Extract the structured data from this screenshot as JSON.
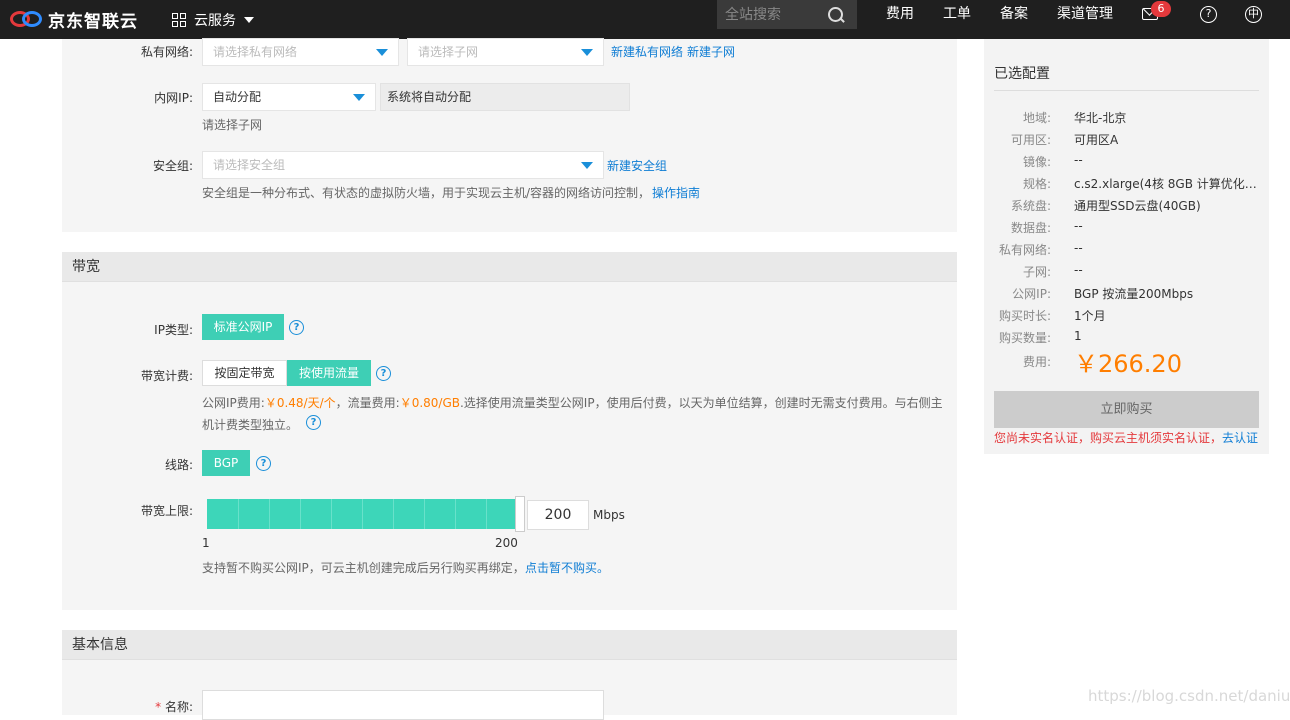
{
  "topbar": {
    "brand": "京东智联云",
    "cloud_menu": "云服务",
    "search_placeholder": "全站搜索",
    "nav": [
      "费用",
      "工单",
      "备案",
      "渠道管理"
    ],
    "mail_count": "6",
    "help_symbol": "?",
    "lang_symbol": "中"
  },
  "network": {
    "vpc_label": "私有网络:",
    "vpc_placeholder": "请选择私有网络",
    "subnet_placeholder": "请选择子网",
    "new_vpc_link": "新建私有网络",
    "new_subnet_link": "新建子网",
    "ip_label": "内网IP:",
    "ip_value": "自动分配",
    "ip_auto_text": "系统将自动分配",
    "ip_hint": "请选择子网",
    "sg_label": "安全组:",
    "sg_placeholder": "请选择安全组",
    "new_sg_link": "新建安全组",
    "sg_hint": "安全组是一种分布式、有状态的虚拟防火墙，用于实现云主机/容器的网络访问控制，",
    "sg_guide_link": "操作指南"
  },
  "bandwidth": {
    "section_title": "带宽",
    "ip_type_label": "IP类型:",
    "ip_type_value": "标准公网IP",
    "billing_label": "带宽计费:",
    "billing_fixed": "按固定带宽",
    "billing_traffic": "按使用流量",
    "fee_prefix": "公网IP费用:",
    "fee_ip_price": "￥0.48/天/个",
    "fee_mid": "，流量费用:",
    "fee_traffic_price": "￥0.80/GB",
    "fee_desc": ".选择使用流量类型公网IP，使用后付费，以天为单位结算，创建时无需支付费用。与右侧主",
    "fee_desc2": "机计费类型独立。",
    "line_label": "线路:",
    "line_value": "BGP",
    "limit_label": "带宽上限:",
    "limit_value": "200",
    "limit_unit": "Mbps",
    "slider_min": "1",
    "slider_max": "200",
    "slider_level": 1.0,
    "skip_hint": "支持暂不购买公网IP，可云主机创建完成后另行购买再绑定，",
    "skip_link": "点击暂不购买。"
  },
  "basic": {
    "section_title": "基本信息",
    "name_star": "*",
    "name_label": "名称:"
  },
  "summary": {
    "title": "已选配置",
    "rows": [
      {
        "k": "地域:",
        "v": "华北-北京"
      },
      {
        "k": "可用区:",
        "v": "可用区A"
      },
      {
        "k": "镜像:",
        "v": "--"
      },
      {
        "k": "规格:",
        "v": "c.s2.xlarge(4核 8GB 计算优化 ..."
      },
      {
        "k": "系统盘:",
        "v": "通用型SSD云盘(40GB)"
      },
      {
        "k": "数据盘:",
        "v": "--"
      },
      {
        "k": "私有网络:",
        "v": "--"
      },
      {
        "k": "子网:",
        "v": "--"
      },
      {
        "k": "公网IP:",
        "v": "BGP 按流量200Mbps"
      },
      {
        "k": "购买时长:",
        "v": "1个月"
      },
      {
        "k": "购买数量:",
        "v": "1"
      }
    ],
    "fee_label": "费用:",
    "price": "￥266.20",
    "buy_button": "立即购买",
    "warn_text": "您尚未实名认证，购买云主机须实名认证，",
    "warn_link": "去认证"
  },
  "watermark": "https://blog.csdn.net/daniud"
}
